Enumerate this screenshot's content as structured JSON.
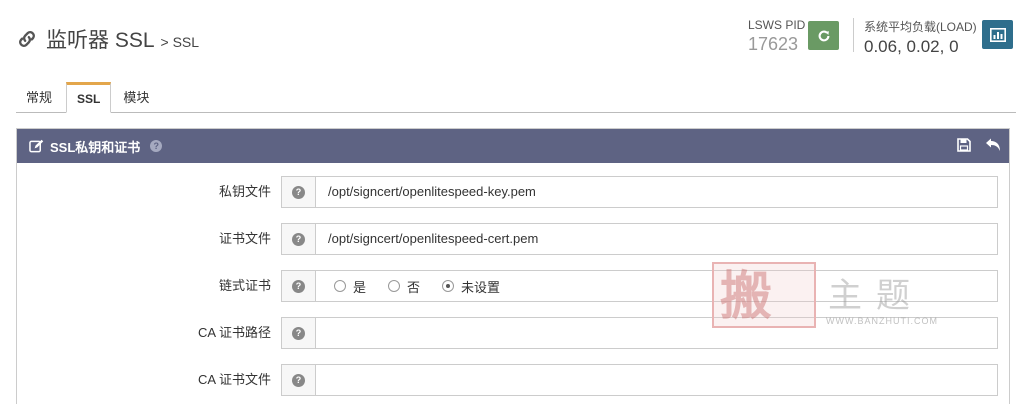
{
  "header": {
    "title": "监听器 SSL",
    "breadcrumb": "> SSL",
    "pid_label": "LSWS PID",
    "pid_value": "17623",
    "load_label": "系统平均负载(LOAD)",
    "load_value": "0.06, 0.02, 0"
  },
  "tabs": [
    {
      "label": "常规",
      "active": false
    },
    {
      "label": "SSL",
      "active": true
    },
    {
      "label": "模块",
      "active": false
    }
  ],
  "panel": {
    "title": "SSL私钥和证书",
    "rows": [
      {
        "label": "私钥文件",
        "value": "/opt/signcert/openlitespeed-key.pem"
      },
      {
        "label": "证书文件",
        "value": "/opt/signcert/openlitespeed-cert.pem"
      },
      {
        "label": "链式证书",
        "value": ""
      },
      {
        "label": "CA 证书路径",
        "value": ""
      },
      {
        "label": "CA 证书文件",
        "value": ""
      }
    ],
    "chain_options": [
      {
        "label": "是",
        "checked": false
      },
      {
        "label": "否",
        "checked": false
      },
      {
        "label": "未设置",
        "checked": true
      }
    ]
  },
  "watermark": {
    "big_char": "搬",
    "text": "主题",
    "url": "WWW.BANZHUTI.COM"
  },
  "colors": {
    "panel_header": "#5e6383",
    "reload_button": "#6a9a64",
    "stats_button": "#2e6e8c",
    "tab_accent": "#e3a64b"
  },
  "icons": {
    "title": "link-icon",
    "reload": "refresh-icon",
    "stats": "bar-chart-icon",
    "edit": "edit-icon",
    "save": "save-icon",
    "back": "undo-icon",
    "help": "question-icon"
  }
}
